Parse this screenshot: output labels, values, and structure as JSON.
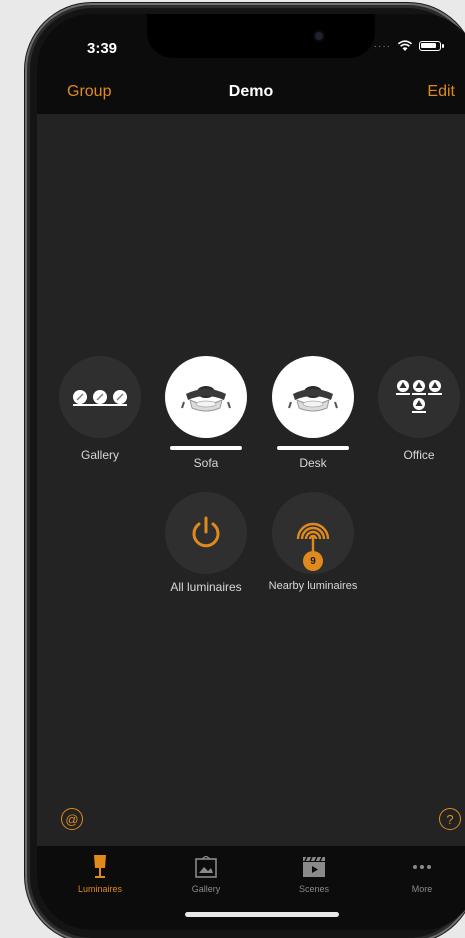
{
  "status_bar": {
    "time": "3:39"
  },
  "nav": {
    "left": "Group",
    "title": "Demo",
    "right": "Edit"
  },
  "groups": [
    {
      "label": "Gallery",
      "selected": false
    },
    {
      "label": "Sofa",
      "selected": true
    },
    {
      "label": "Desk",
      "selected": true
    },
    {
      "label": "Office",
      "selected": false
    }
  ],
  "actions": {
    "all_luminaires": "All luminaires",
    "nearby_luminaires": "Nearby luminaires",
    "nearby_count": "9"
  },
  "tabs": [
    {
      "label": "Luminaires",
      "icon": "lamp-icon",
      "active": true
    },
    {
      "label": "Gallery",
      "icon": "gallery-icon",
      "active": false
    },
    {
      "label": "Scenes",
      "icon": "clapperboard-icon",
      "active": false
    },
    {
      "label": "More",
      "icon": "more-dots-icon",
      "active": false
    }
  ],
  "colors": {
    "accent": "#e08a1e",
    "background": "#232323",
    "bar": "#0c0c0c"
  }
}
